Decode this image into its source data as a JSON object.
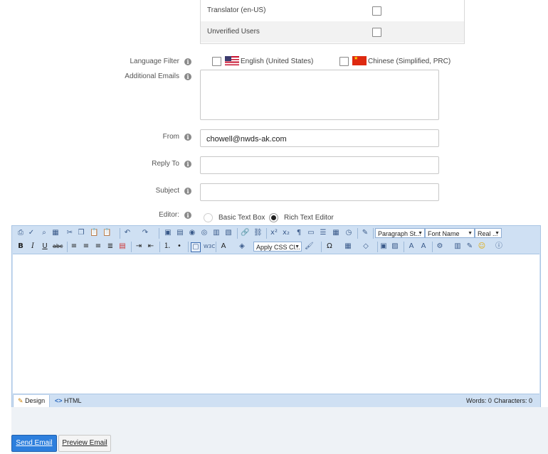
{
  "roles": [
    {
      "label": "Translator (en-US)",
      "checked": false
    },
    {
      "label": "Unverified Users",
      "checked": false
    }
  ],
  "language_filter": {
    "label": "Language Filter",
    "options": [
      {
        "label": "English (United States)",
        "flag": "us-flag-icon",
        "checked": false
      },
      {
        "label": "Chinese (Simplified, PRC)",
        "flag": "cn-flag-icon",
        "checked": false
      }
    ]
  },
  "additional_emails": {
    "label": "Additional Emails",
    "value": ""
  },
  "from": {
    "label": "From",
    "value": "chowell@nwds-ak.com"
  },
  "reply_to": {
    "label": "Reply To",
    "value": ""
  },
  "subject": {
    "label": "Subject",
    "value": ""
  },
  "editor_choice": {
    "label": "Editor:",
    "options": [
      {
        "label": "Basic Text Box",
        "selected": false
      },
      {
        "label": "Rich Text Editor",
        "selected": true
      }
    ]
  },
  "toolbar": {
    "paragraph_style": "Paragraph St...",
    "font_name": "Font Name",
    "font_size": "Real ...",
    "css_class": "Apply CSS Cl..."
  },
  "editor_modes": {
    "design": "Design",
    "html": "HTML"
  },
  "editor_stats": {
    "words": "Words: 0",
    "characters": "Characters: 0"
  },
  "buttons": {
    "send": "Send Email",
    "preview": "Preview Email"
  },
  "colors": {
    "accent": "#2d7fdd",
    "toolbar_bg": "#cfe0f3"
  }
}
